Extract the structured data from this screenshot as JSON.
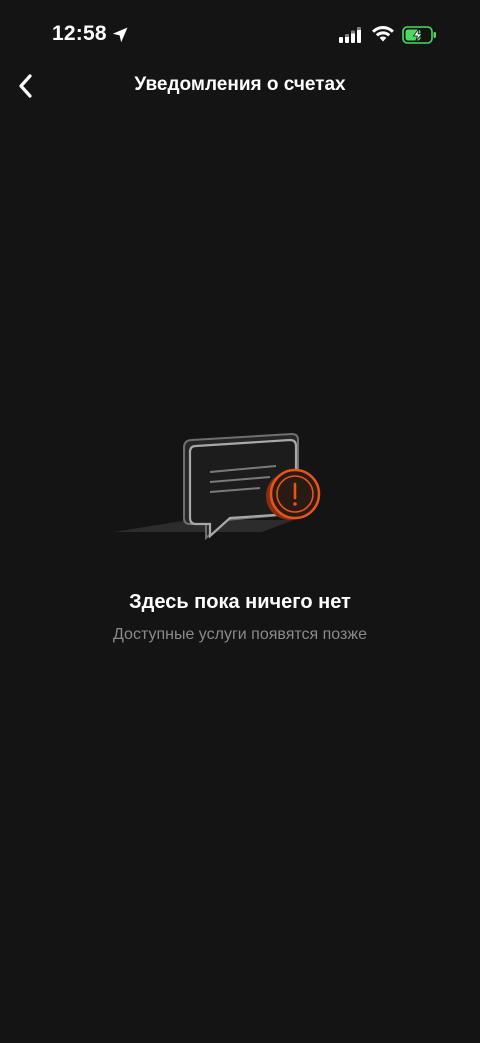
{
  "status_bar": {
    "time": "12:58",
    "icons": [
      "location-arrow-icon",
      "signal-icon",
      "wifi-icon",
      "battery-charging-icon"
    ],
    "battery_color": "#4cd964"
  },
  "header": {
    "back_icon": "chevron-left-icon",
    "title": "Уведомления о счетах"
  },
  "empty_state": {
    "illustration": "chat-bubble-alert-icon",
    "title": "Здесь пока ничего нет",
    "subtitle": "Доступные услуги появятся позже",
    "accent_color": "#e8541c"
  },
  "colors": {
    "background": "#141414",
    "text_primary": "#ffffff",
    "text_secondary": "#8a8a8a"
  }
}
